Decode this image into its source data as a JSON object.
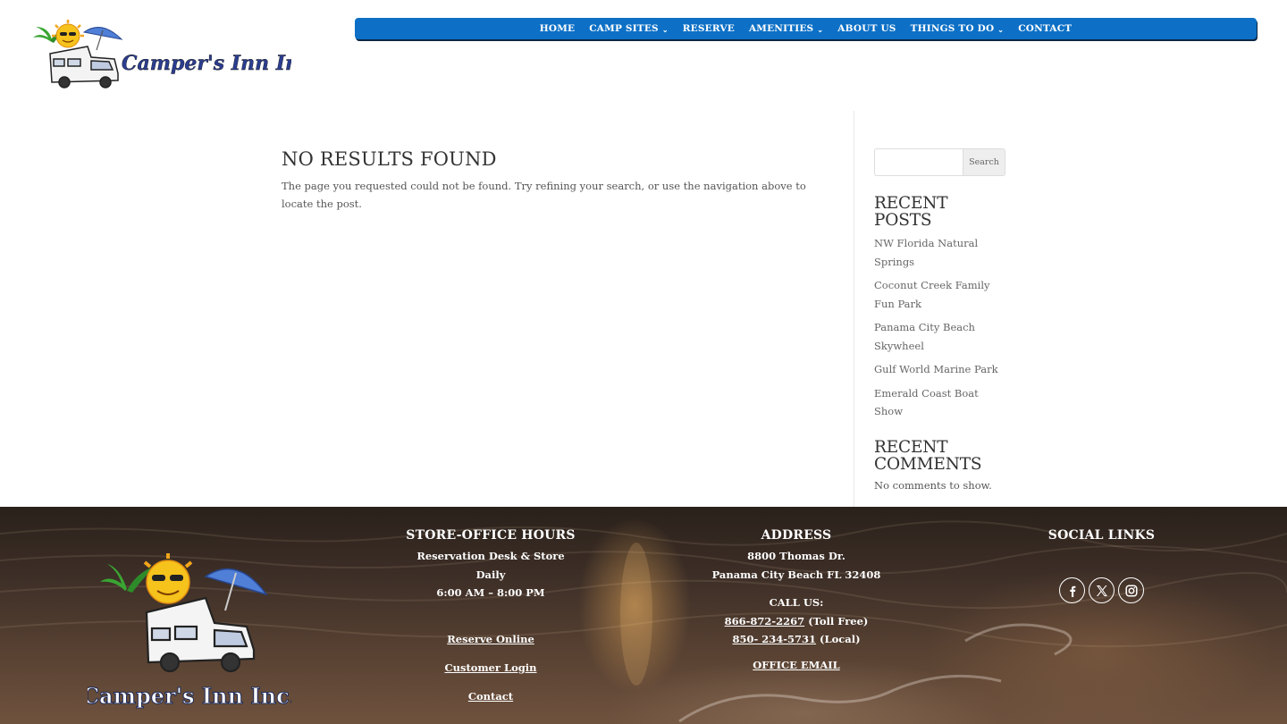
{
  "header": {
    "logo_text": "Camper's Inn Inc.",
    "nav": [
      {
        "label": "HOME",
        "has_dropdown": false
      },
      {
        "label": "CAMP SITES",
        "has_dropdown": true
      },
      {
        "label": "RESERVE",
        "has_dropdown": false
      },
      {
        "label": "AMENITIES",
        "has_dropdown": true
      },
      {
        "label": "ABOUT US",
        "has_dropdown": false
      },
      {
        "label": "THINGS TO DO",
        "has_dropdown": true
      },
      {
        "label": "CONTACT",
        "has_dropdown": false
      }
    ],
    "nav_color": "#0d70c6"
  },
  "main": {
    "title": "NO RESULTS FOUND",
    "message": "The page you requested could not be found. Try refining your search, or use the navigation above to locate the post."
  },
  "sidebar": {
    "search": {
      "placeholder": "",
      "button_label": "Search"
    },
    "recent_posts_title": "RECENT POSTS",
    "recent_posts": [
      "NW Florida Natural Springs",
      "Coconut Creek Family Fun Park",
      "Panama City Beach Skywheel",
      "Gulf World Marine Park",
      "Emerald Coast Boat Show"
    ],
    "recent_comments_title": "RECENT COMMENTS",
    "no_comments": "No comments to show."
  },
  "footer": {
    "logo_text": "Camper's Inn Inc.",
    "hours": {
      "title": "STORE-OFFICE HOURS",
      "line1": "Reservation Desk & Store",
      "line2": "Daily",
      "line3": "6:00 AM – 8:00 PM",
      "links": [
        "Reserve Online",
        "Customer Login",
        "Contact"
      ]
    },
    "address": {
      "title": "ADDRESS",
      "street": "8800 Thomas Dr.",
      "city": "Panama City Beach FL 32408",
      "call_label": "CALL US:",
      "phone1": "866-872-2267",
      "phone1_note": " (Toll Free)",
      "phone2": "850- 234-5731",
      "phone2_note": " (Local)",
      "email_link": "OFFICE EMAIL"
    },
    "social": {
      "title": "SOCIAL LINKS",
      "icons": [
        "facebook-icon",
        "x-icon",
        "instagram-icon"
      ]
    }
  }
}
